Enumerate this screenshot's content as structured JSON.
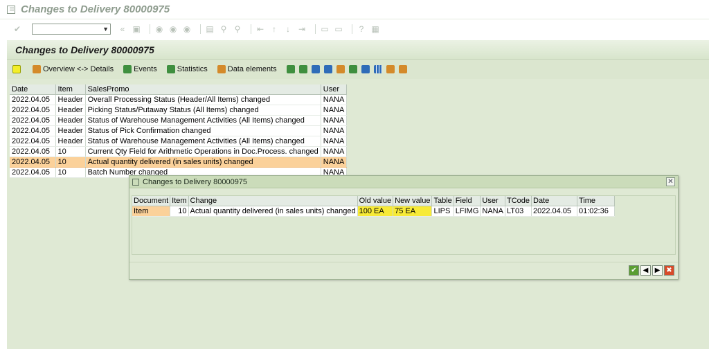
{
  "window": {
    "title": "Changes to Delivery 80000975"
  },
  "app": {
    "title": "Changes to Delivery 80000975",
    "toolbar": {
      "overview": "Overview <-> Details",
      "events": "Events",
      "statistics": "Statistics",
      "data_elements": "Data elements"
    }
  },
  "log_table": {
    "columns": [
      "Date",
      "Item",
      "SalesPromo",
      "User"
    ],
    "rows": [
      {
        "date": "2022.04.05",
        "item": "Header",
        "text": "Overall Processing Status (Header/All Items) changed",
        "user": "NANA"
      },
      {
        "date": "2022.04.05",
        "item": "Header",
        "text": "Picking Status/Putaway Status (All Items) changed",
        "user": "NANA"
      },
      {
        "date": "2022.04.05",
        "item": "Header",
        "text": "Status of Warehouse Management Activities (All Items) changed",
        "user": "NANA"
      },
      {
        "date": "2022.04.05",
        "item": "Header",
        "text": "Status of Pick Confirmation changed",
        "user": "NANA"
      },
      {
        "date": "2022.04.05",
        "item": "Header",
        "text": "Status of Warehouse Management Activities (All Items) changed",
        "user": "NANA"
      },
      {
        "date": "2022.04.05",
        "item": "10",
        "text": "Current Qty Field for Arithmetic Operations in Doc.Process. changed",
        "user": "NANA"
      },
      {
        "date": "2022.04.05",
        "item": "10",
        "text": "Actual quantity delivered (in sales units) changed",
        "user": "NANA"
      },
      {
        "date": "2022.04.05",
        "item": "10",
        "text": "Batch Number changed",
        "user": "NANA"
      }
    ]
  },
  "dialog": {
    "title": "Changes to Delivery 80000975",
    "close_glyph": "✕",
    "columns": [
      "Document",
      "Item",
      "Change",
      "Old value",
      "New value",
      "Table",
      "Field",
      "User",
      "TCode",
      "Date",
      "Time"
    ],
    "row": {
      "document": "Item",
      "item": "10",
      "change": "Actual quantity delivered (in sales units) changed",
      "old_value": "100 EA",
      "new_value": "75 EA",
      "table": "LIPS",
      "field": "LFIMG",
      "user": "NANA",
      "tcode": "LT03",
      "date": "2022.04.05",
      "time": "01:02:36"
    },
    "buttons": {
      "ok": "✔",
      "prev": "◀",
      "next": "▶",
      "cancel": "✖"
    }
  },
  "colors": {
    "highlight": "#f7ea37",
    "selected_row": "#fbd19a",
    "app_background": "#dfe9d4"
  }
}
